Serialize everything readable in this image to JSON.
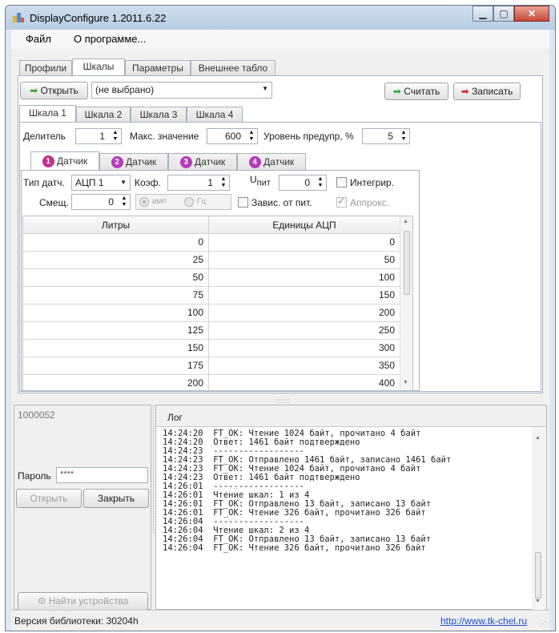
{
  "window": {
    "title": "DisplayConfigure 1.2011.6.22"
  },
  "menu": {
    "file": "Файл",
    "about": "О программе..."
  },
  "top_tabs": [
    "Профили",
    "Шкалы",
    "Параметры",
    "Внешнее табло"
  ],
  "toolbar": {
    "open_label": "Открыть",
    "file_value": "(не выбрано)",
    "read_label": "Считать",
    "write_label": "Записать"
  },
  "scale_tabs": [
    "Шкала 1",
    "Шкала 2",
    "Шкала 3",
    "Шкала 4"
  ],
  "scale_params": {
    "divider_label": "Делитель",
    "divider_value": "1",
    "max_label": "Макс. значение",
    "max_value": "600",
    "warn_label": "Уровень предупр, %",
    "warn_value": "5"
  },
  "sensor_tabs": [
    {
      "num": "1",
      "label": "Датчик",
      "color": "#c2318f"
    },
    {
      "num": "2",
      "label": "Датчик",
      "color": "#b43ab8"
    },
    {
      "num": "3",
      "label": "Датчик",
      "color": "#b43ab8"
    },
    {
      "num": "4",
      "label": "Датчик",
      "color": "#b43ab8"
    }
  ],
  "sensor": {
    "type_label": "Тип датч.",
    "type_value": "АЦП 1",
    "coef_label": "Коэф.",
    "coef_value": "1",
    "upit_label_main": "U",
    "upit_label_sub": "пит",
    "upit_value": "0",
    "integr_label": "Интегрир.",
    "offset_label": "Смещ.",
    "offset_value": "0",
    "radio_imp": "имп",
    "radio_hz": "Гц",
    "depend_label": "Завис. от пит.",
    "approx_label": "Аппрокс."
  },
  "grid": {
    "headers": [
      "Литры",
      "Единицы АЦП"
    ],
    "rows": [
      [
        "0",
        "0"
      ],
      [
        "25",
        "50"
      ],
      [
        "50",
        "100"
      ],
      [
        "75",
        "150"
      ],
      [
        "100",
        "200"
      ],
      [
        "125",
        "250"
      ],
      [
        "150",
        "300"
      ],
      [
        "175",
        "350"
      ],
      [
        "200",
        "400"
      ]
    ]
  },
  "device": {
    "id": "1000052",
    "password_label": "Пароль",
    "password_value": "****",
    "open_label": "Открыть",
    "close_label": "Закрыть",
    "find_label": "Найти устройства"
  },
  "log": {
    "title": "Лог",
    "lines": [
      "14:24:20  FT_OK: Чтение 1024 байт, прочитано 4 байт",
      "14:24:20  Ответ: 1461 байт подтверждено",
      "14:24:23  ------------------",
      "14:24:23  FT_OK: Отправлено 1461 байт, записано 1461 байт",
      "14:24:23  FT_OK: Чтение 1024 байт, прочитано 4 байт",
      "14:24:23  Ответ: 1461 байт подтверждено",
      "14:26:01  ------------------",
      "14:26:01  Чтение шкал: 1 из 4",
      "14:26:01  FT_OK: Отправлено 13 байт, записано 13 байт",
      "14:26:01  FT_OK: Чтение 326 байт, прочитано 326 байт",
      "14:26:04  ------------------",
      "14:26:04  Чтение шкал: 2 из 4",
      "14:26:04  FT_OK: Отправлено 13 байт, записано 13 байт",
      "14:26:04  FT_OK: Чтение 326 байт, прочитано 326 байт"
    ]
  },
  "status": {
    "library": "Версия библиотеки: 30204h",
    "link": "http://www.tk-chel.ru"
  },
  "colors": {
    "link": "#1a4bd0",
    "read_arrow": "#3aa83a",
    "write_arrow": "#d42a2a"
  }
}
